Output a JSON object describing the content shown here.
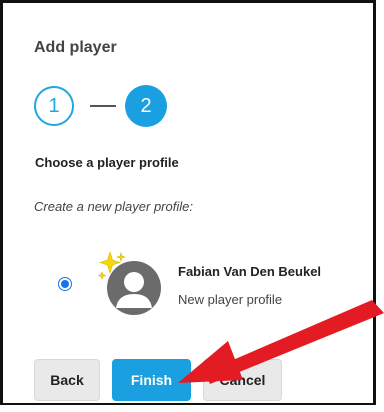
{
  "dialog": {
    "title": "Add player"
  },
  "steps": [
    {
      "label": "1",
      "state": "completed"
    },
    {
      "label": "2",
      "state": "active"
    }
  ],
  "profile_section": {
    "heading": "Choose a player profile",
    "create_label": "Create a new player profile:"
  },
  "profile": {
    "name": "Fabian Van Den Beukel",
    "subtitle": "New player profile",
    "selected": true
  },
  "buttons": {
    "back": "Back",
    "finish": "Finish",
    "cancel": "Cancel"
  },
  "colors": {
    "accent": "#1a9fe0",
    "annotation_arrow": "#e31b23",
    "sparkle": "#f5d60a"
  },
  "icons": {
    "avatar": "person-silhouette-icon",
    "sparkle": "sparkle-icon",
    "annotation": "arrow-icon"
  }
}
